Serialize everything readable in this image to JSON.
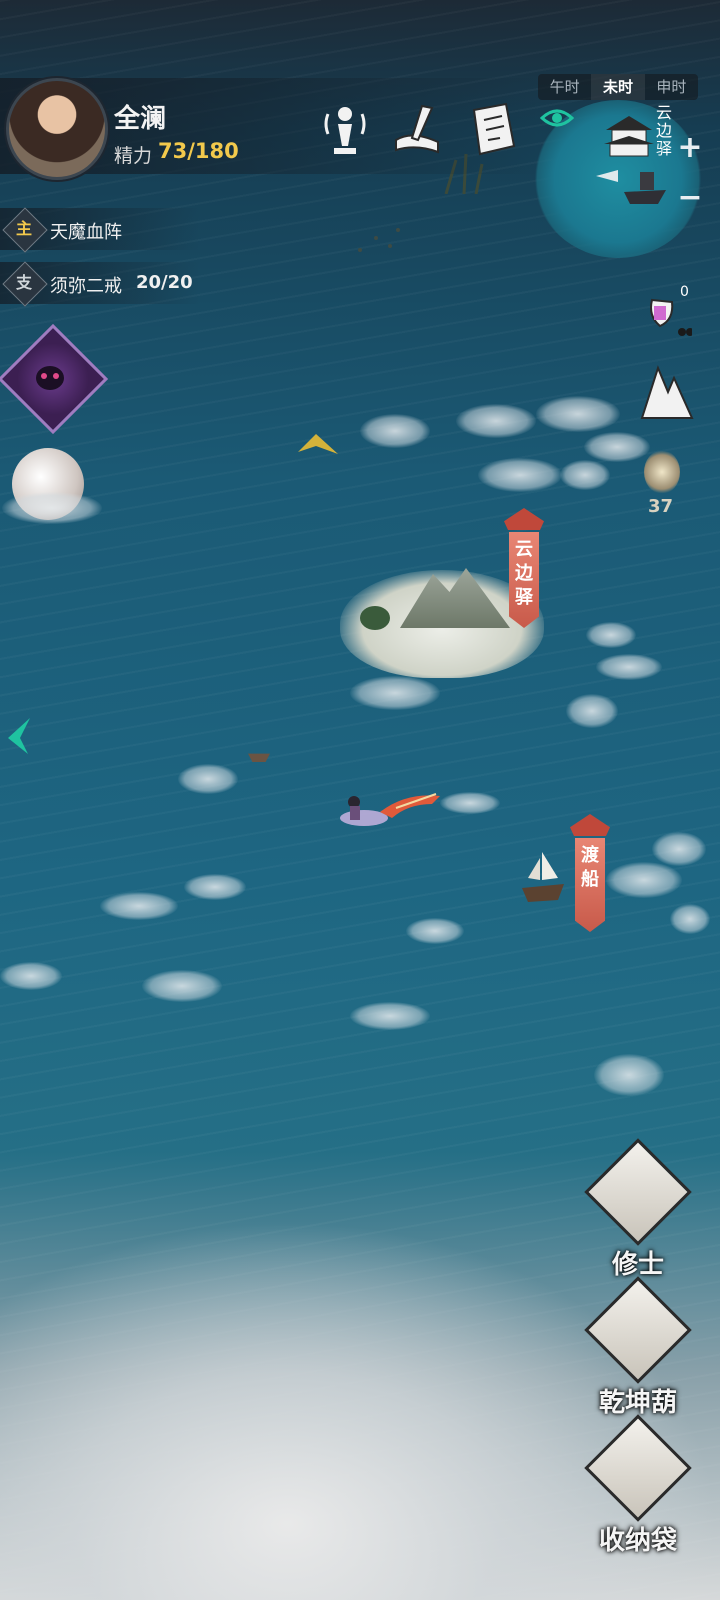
{
  "player": {
    "name": "全澜",
    "stamina_label": "精力",
    "stamina_value": "73/180"
  },
  "time": {
    "items": [
      "午时",
      "未时",
      "申时"
    ],
    "active": "未时"
  },
  "minimap": {
    "location_label": "云边驿"
  },
  "quests": [
    {
      "tag": "主",
      "title": "天魔血阵",
      "progress": ""
    },
    {
      "tag": "支",
      "title": "须弥二戒",
      "progress": "20/20"
    }
  ],
  "side_badges": {
    "notification_count": "0",
    "spirit_count": "37"
  },
  "map_labels": {
    "outpost": "云边驿",
    "ferry": "渡船"
  },
  "buttons": {
    "cultivator": "修士",
    "gourd": "乾坤葫",
    "storage_bag": "收纳袋"
  },
  "zoom": {
    "in": "+",
    "out": "−"
  }
}
